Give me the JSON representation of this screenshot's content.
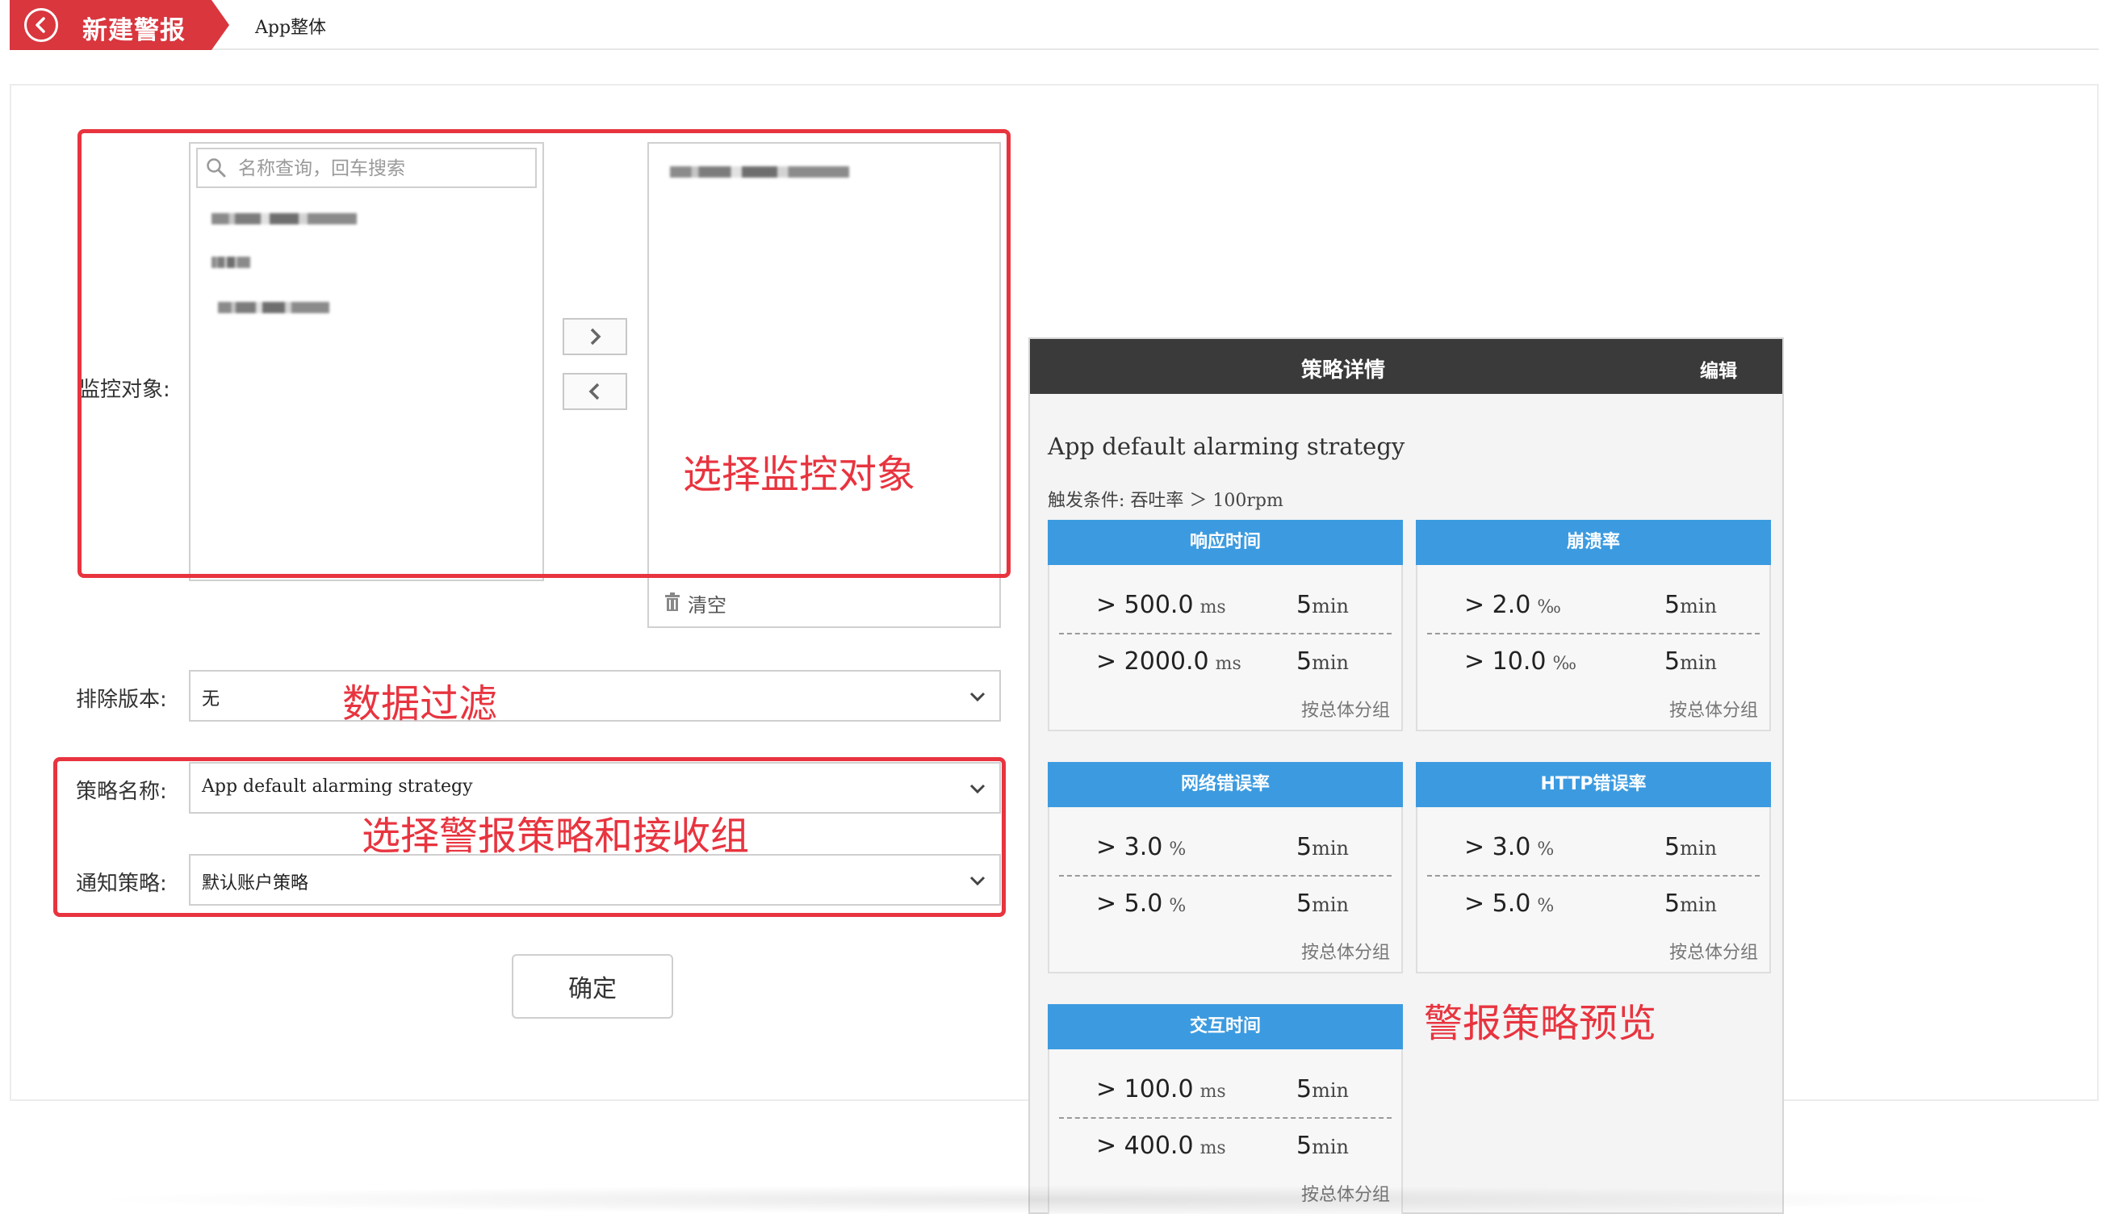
{
  "header": {
    "back_title": "新建警报",
    "breadcrumb": "App整体"
  },
  "form": {
    "monitor_label": "监控对象:",
    "search_placeholder": "名称查询，回车搜索",
    "clear_label": "清空",
    "exclude_label": "排除版本:",
    "exclude_value": "无",
    "strategy_label": "策略名称:",
    "strategy_value": "App default alarming strategy",
    "notify_label": "通知策略:",
    "notify_value": "默认账户策略",
    "confirm_label": "确定"
  },
  "annotations": {
    "select_target": "选择监控对象",
    "data_filter": "数据过滤",
    "select_strategy": "选择警报策略和接收组",
    "preview": "警报策略预览"
  },
  "detail": {
    "title": "策略详情",
    "edit": "编辑",
    "strategy_name": "App default alarming strategy",
    "trigger": "触发条件: 吞吐率 ＞ 100rpm",
    "cards": [
      {
        "title": "响应时间",
        "rows": [
          {
            "thr": "> 500.0",
            "unit": "ms",
            "dur": "5",
            "dur_unit": "min"
          },
          {
            "thr": "> 2000.0",
            "unit": "ms",
            "dur": "5",
            "dur_unit": "min"
          }
        ],
        "group": "按总体分组"
      },
      {
        "title": "崩溃率",
        "rows": [
          {
            "thr": "> 2.0",
            "unit": "‰",
            "dur": "5",
            "dur_unit": "min"
          },
          {
            "thr": "> 10.0",
            "unit": "‰",
            "dur": "5",
            "dur_unit": "min"
          }
        ],
        "group": "按总体分组"
      },
      {
        "title": "网络错误率",
        "rows": [
          {
            "thr": "> 3.0",
            "unit": "%",
            "dur": "5",
            "dur_unit": "min"
          },
          {
            "thr": "> 5.0",
            "unit": "%",
            "dur": "5",
            "dur_unit": "min"
          }
        ],
        "group": "按总体分组"
      },
      {
        "title": "HTTP错误率",
        "rows": [
          {
            "thr": "> 3.0",
            "unit": "%",
            "dur": "5",
            "dur_unit": "min"
          },
          {
            "thr": "> 5.0",
            "unit": "%",
            "dur": "5",
            "dur_unit": "min"
          }
        ],
        "group": "按总体分组"
      },
      {
        "title": "交互时间",
        "rows": [
          {
            "thr": "> 100.0",
            "unit": "ms",
            "dur": "5",
            "dur_unit": "min"
          },
          {
            "thr": "> 400.0",
            "unit": "ms",
            "dur": "5",
            "dur_unit": "min"
          }
        ],
        "group": "按总体分组"
      }
    ]
  },
  "colors": {
    "brand_red": "#d9363e",
    "annotation_red": "#e8343f",
    "card_blue": "#3c9be0",
    "dark_header": "#3a3a3a"
  }
}
